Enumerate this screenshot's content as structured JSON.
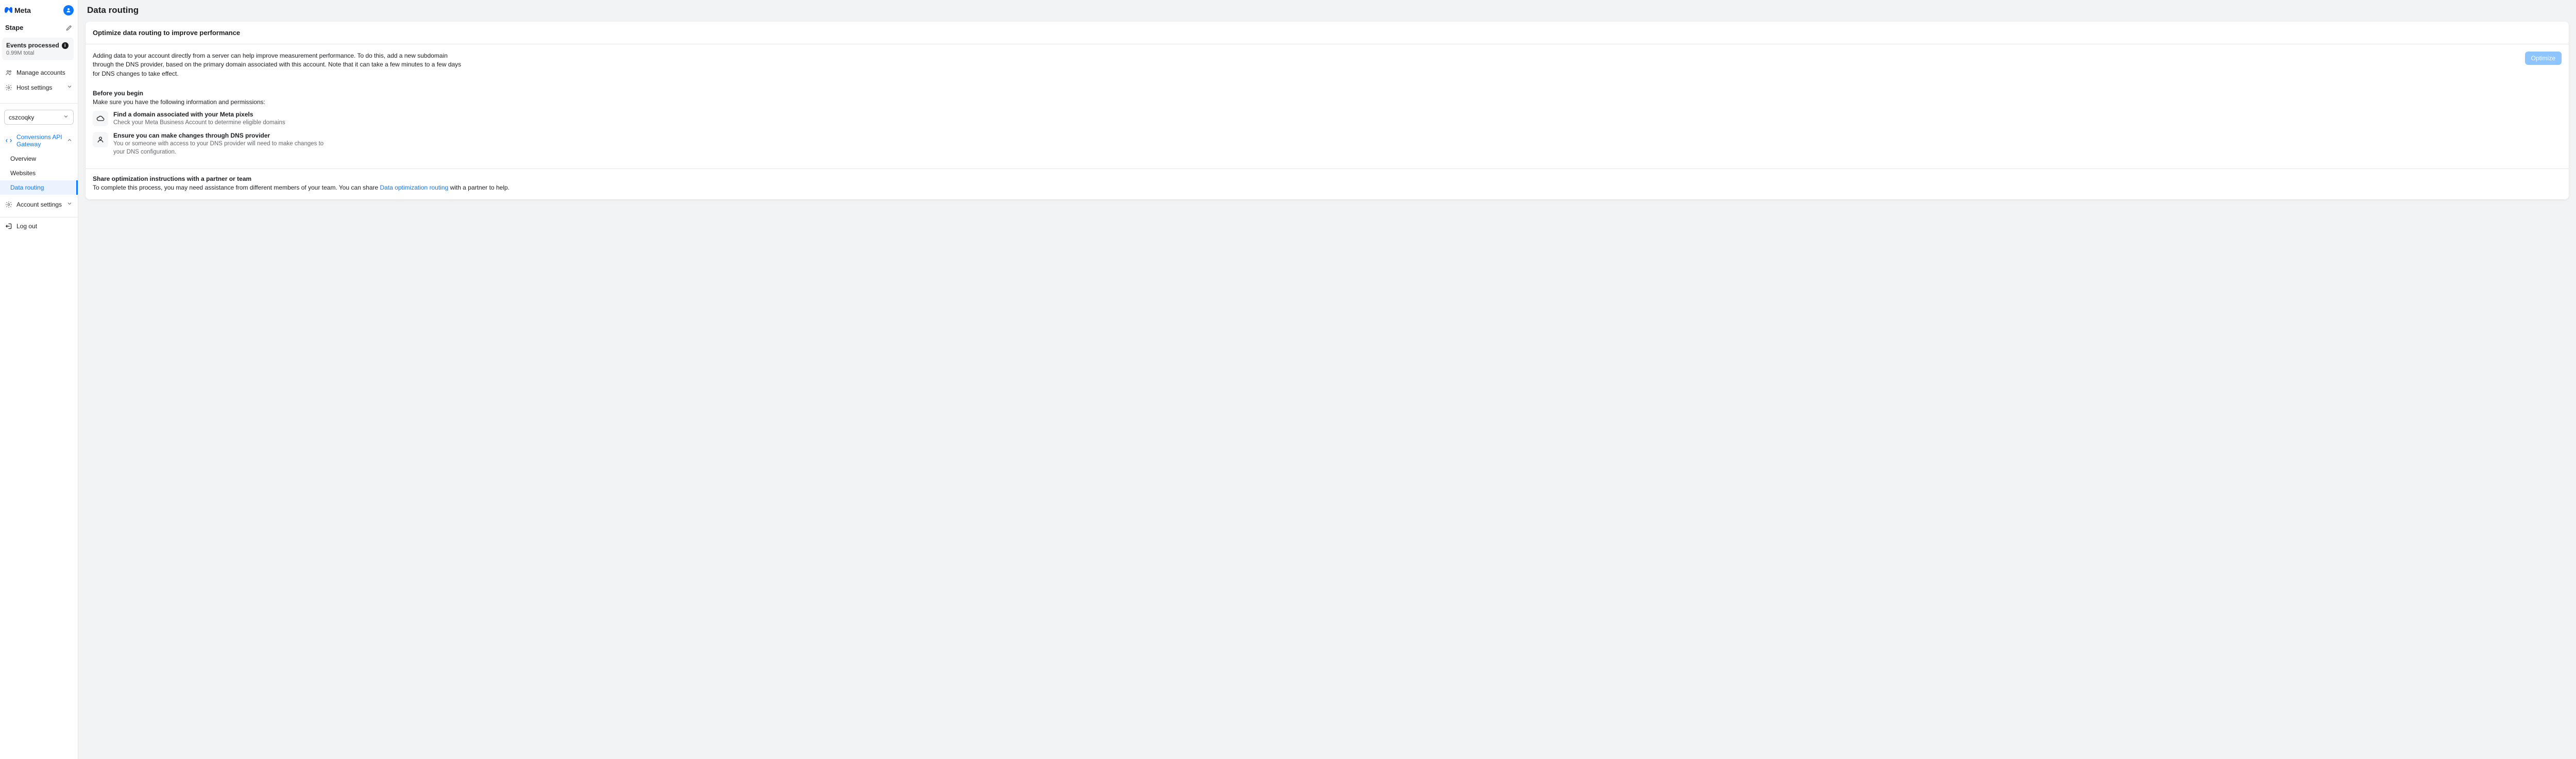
{
  "brand": {
    "name": "Meta"
  },
  "org": {
    "name": "Stape"
  },
  "events": {
    "title": "Events processed",
    "total": "0.99M total"
  },
  "nav": {
    "manage_accounts": "Manage accounts",
    "host_settings": "Host settings"
  },
  "account_selector": {
    "value": "cszcoqky"
  },
  "gateway_section": {
    "label": "Conversions API Gateway",
    "items": {
      "overview": "Overview",
      "websites": "Websites",
      "data_routing": "Data routing"
    }
  },
  "account_settings": "Account settings",
  "logout": "Log out",
  "page": {
    "title": "Data routing",
    "card_title": "Optimize data routing to improve performance",
    "intro": "Adding data to your account directly from a server can help improve measurement performance. To do this, add a new subdomain through the DNS provider, based on the primary domain associated with this account. Note that it can take a few minutes to a few days for DNS changes to take effect.",
    "optimize_btn": "Optimize",
    "before_heading": "Before you begin",
    "before_sub": "Make sure you have the following information and permissions:",
    "prep1_title": "Find a domain associated with your Meta pixels",
    "prep1_desc": "Check your Meta Business Account to determine eligible domains",
    "prep2_title": "Ensure you can make changes through DNS provider",
    "prep2_desc": "You or someone with access to your DNS provider will need to make changes to your DNS configuration.",
    "share_title": "Share optimization instructions with a partner or team",
    "share_text_pre": "To complete this process, you may need assistance from different members of your team. You can share ",
    "share_link": "Data optimization routing",
    "share_text_post": " with a partner to help."
  }
}
